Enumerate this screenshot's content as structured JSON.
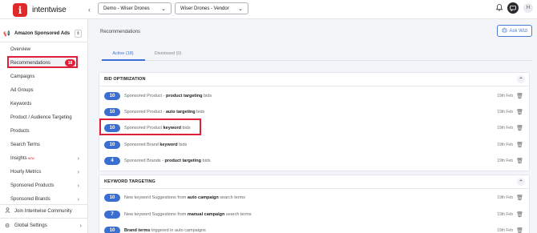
{
  "header": {
    "logo_letter": "i",
    "logo_text": "intentwise",
    "collapse_icon": "chevron-left-icon",
    "account_dropdown": "Demo - Wiser Drones",
    "profile_dropdown": "Wiser Drones - Vendor",
    "avatar_initial": "H"
  },
  "sidebar": {
    "module_name": "Amazon Sponsored Ads",
    "items": [
      {
        "label": "Overview"
      },
      {
        "label": "Recommendations",
        "badge": "18"
      },
      {
        "label": "Campaigns"
      },
      {
        "label": "Ad Groups"
      },
      {
        "label": "Keywords"
      },
      {
        "label": "Product / Audience Targeting"
      },
      {
        "label": "Products"
      },
      {
        "label": "Search Terms"
      },
      {
        "label": "Insights",
        "tag": "NEW"
      },
      {
        "label": "Hourly Metrics"
      },
      {
        "label": "Sponsored Products"
      },
      {
        "label": "Sponsored Brands"
      }
    ],
    "community_link": "Join Intentwise Community",
    "global_settings": "Global Settings"
  },
  "main": {
    "page_title": "Recommendations",
    "ask_button": "Ask Wizi",
    "tabs": [
      {
        "label": "Active (18)",
        "active": true
      },
      {
        "label": "Dismissed (0)",
        "active": false
      }
    ],
    "sections": [
      {
        "title": "BID OPTIMIZATION",
        "rows": [
          {
            "count": "10",
            "pre": "Sponsored Product - ",
            "bold": "product targeting",
            "post": " bids",
            "date": "19th Feb"
          },
          {
            "count": "10",
            "pre": "Sponsored Product - ",
            "bold": "auto targeting",
            "post": " bids",
            "date": "19th Feb"
          },
          {
            "count": "10",
            "pre": "Sponsored Product ",
            "bold": "keyword",
            "post": " bids",
            "date": "19th Feb"
          },
          {
            "count": "10",
            "pre": "Sponsored Brand ",
            "bold": "keyword",
            "post": " bids",
            "date": "19th Feb"
          },
          {
            "count": "4",
            "pre": "Sponsored Brands - ",
            "bold": "product targeting",
            "post": " bids",
            "date": "19th Feb"
          }
        ]
      },
      {
        "title": "KEYWORD TARGETING",
        "rows": [
          {
            "count": "10",
            "pre": "New keyword Suggestions from ",
            "bold": "auto campaign",
            "post": " search terms",
            "date": "19th Feb"
          },
          {
            "count": "7",
            "pre": "New keyword Suggestions from ",
            "bold": "manual campaign",
            "post": " search terms",
            "date": "19th Feb"
          },
          {
            "count": "10",
            "pre": "",
            "bold": "Brand terms",
            "post": " triggered in auto campaigns",
            "date": "19th Feb"
          }
        ]
      }
    ]
  },
  "colors": {
    "accent_blue": "#3a6fd1",
    "highlight_red": "#e0203a",
    "brand_red": "#e02a2a"
  }
}
